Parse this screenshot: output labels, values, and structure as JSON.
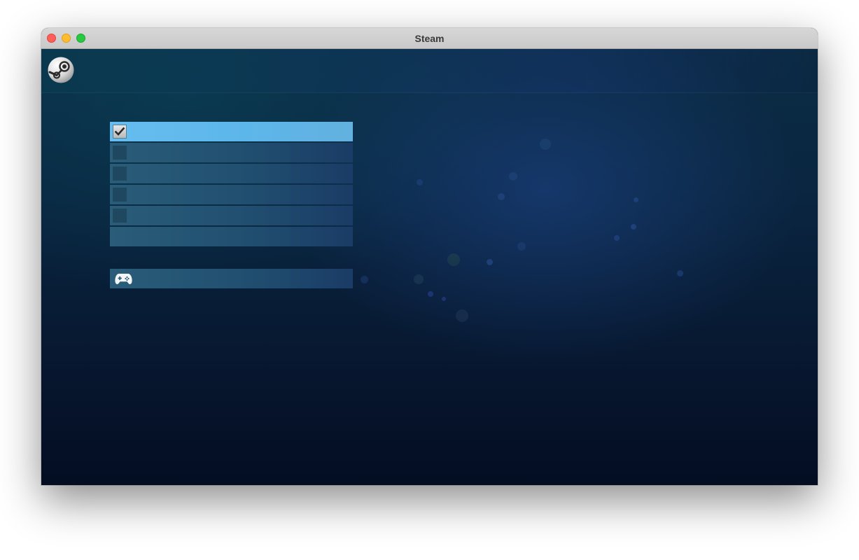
{
  "window": {
    "title": "Steam"
  },
  "branding": {
    "logo": "steam-logo-icon"
  },
  "menu": {
    "items": [
      {
        "checked": true,
        "icon": "checkmark-icon"
      },
      {
        "checked": false
      },
      {
        "checked": false
      },
      {
        "checked": false
      },
      {
        "checked": false
      },
      {
        "checked": null
      }
    ],
    "controller_item": {
      "icon": "gamepad-icon"
    }
  },
  "colors": {
    "selected_highlight": "#66bdef",
    "item_background": "#2a5d79",
    "background_top": "#0b2c45",
    "background_bottom": "#040d22"
  }
}
